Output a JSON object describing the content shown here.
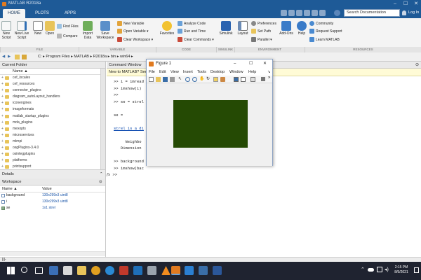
{
  "window": {
    "title": "MATLAB R2018a"
  },
  "tabs": [
    "HOME",
    "PLOTS",
    "APPS"
  ],
  "search": {
    "placeholder": "Search Documentation"
  },
  "login": "Log In",
  "ribbon": {
    "new_script": "New Script",
    "new_live_script": "New Live Script",
    "new": "New",
    "open": "Open",
    "find_files": "Find Files",
    "compare": "Compare",
    "import_data": "Import Data",
    "save_workspace": "Save Workspace",
    "new_variable": "New Variable",
    "open_variable": "Open Variable",
    "clear_workspace": "Clear Workspace",
    "favorites": "Favorites",
    "analyze_code": "Analyze Code",
    "run_and_time": "Run and Time",
    "clear_commands": "Clear Commands",
    "simulink": "Simulink",
    "layout": "Layout",
    "preferences": "Preferences",
    "set_path": "Set Path",
    "parallel": "Parallel",
    "add_ons": "Add-Ons",
    "help": "Help",
    "community": "Community",
    "request_support": "Request Support",
    "learn_matlab": "Learn MATLAB",
    "groups": [
      "FILE",
      "VARIABLE",
      "CODE",
      "SIMULINK",
      "ENVIRONMENT",
      "RESOURCES"
    ]
  },
  "address": {
    "path": "C: ▸ Program Files ▸ MATLAB ▸ R2018a ▸ bin ▸ win64 ▸"
  },
  "current_folder": {
    "title": "Current Folder",
    "column": "Name ▲",
    "items": [
      "cef_locales",
      "cef_resources",
      "connector_plugins",
      "diagram_autoLayout_handlers",
      "iconengines",
      "imageformats",
      "matlab_startup_plugins",
      "mda_plugins",
      "mexopts",
      "microservices",
      "mlmpi",
      "osgPlugins-3.4.0",
      "osintegplugins",
      "platforms",
      "printsupport"
    ],
    "details": "Details"
  },
  "workspace": {
    "title": "Workspace",
    "col_name": "Name ▲",
    "col_value": "Value",
    "rows": [
      {
        "name": "background",
        "value": "130x299x3 uint8"
      },
      {
        "name": "i",
        "value": "130x299x3 uint8"
      },
      {
        "name": "se",
        "value": "1x1 strel"
      }
    ]
  },
  "command_window": {
    "title": "Command Window",
    "banner": "New to MATLAB? See r",
    "lines": [
      ">> i = imread",
      ">> imshow(i)",
      ">>",
      ">> se = strel",
      "",
      "se =",
      "",
      "strel is a di",
      "",
      "     Neighbo",
      "   Dimension",
      "",
      ">> background",
      ">> imshow(bac"
    ],
    "prompt": ">>",
    "fx": "fx"
  },
  "figure": {
    "title": "Figure 1",
    "menus": [
      "File",
      "Edit",
      "View",
      "Insert",
      "Tools",
      "Desktop",
      "Window",
      "Help"
    ],
    "image_color": "#254a04"
  },
  "status": {
    "text": "|||-"
  },
  "taskbar": {
    "time": "2:15 PM",
    "date": "8/9/2021"
  },
  "colors": {
    "titlebar": "#1e5a97",
    "taskbar": "#1f2330",
    "accent": "#0057a8"
  }
}
